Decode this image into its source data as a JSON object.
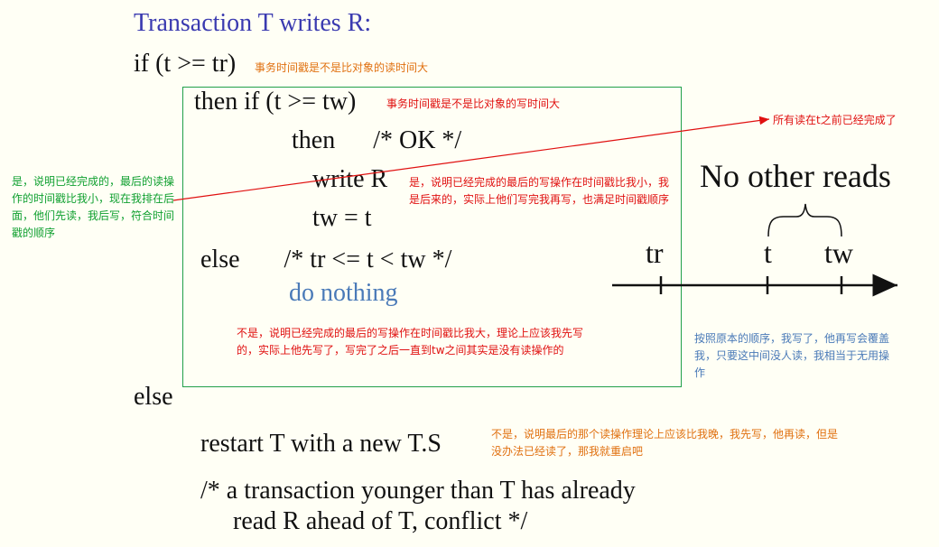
{
  "title": "Transaction T writes R:",
  "lines": {
    "if_line": "if (t >= tr)",
    "then_if": "then if (t >= tw)",
    "then_ok": "then      /* OK */",
    "write_r": "write R",
    "tw_eq_t": "tw = t",
    "else_inner": "else       /* tr <= t < tw */",
    "do_nothing": "do nothing",
    "else_outer": "else",
    "restart": "restart T with a new T.S",
    "comment1": "/* a transaction younger than T has already",
    "comment2": "read R ahead of T, conflict */"
  },
  "timeline": {
    "heading": "No other reads",
    "label_tr": "tr",
    "label_t": "t",
    "label_tw": "tw"
  },
  "notes": {
    "note_if": "事务时间戳是不是比对象的读时间大",
    "note_then_if": "事务时间戳是不是比对象的写时间大",
    "note_arrow": "所有读在t之前已经完成了",
    "note_green": "是，说明已经完成的，最后的读操作的时间戳比我小，现在我排在后面，他们先读，我后写，符合时间戳的顺序",
    "note_write": "是，说明已经完成的最后的写操作在时间戳比我小，我是后来的，实际上他们写完我再写，也满足时间戳顺序",
    "note_else_inner": "不是，说明已经完成的最后的写操作在时间戳比我大，理论上应该我先写的，实际上他先写了，写完了之后一直到tw之间其实是没有读操作的",
    "note_blue": "按照原本的顺序，我写了，他再写会覆盖我，只要这中间没人读，我相当于无用操作",
    "note_restart": "不是，说明最后的那个读操作理论上应该比我晚，我先写，他再读，但是没办法已经读了，那我就重启吧"
  },
  "colors": {
    "title": "#3a3ab0",
    "box": "#22a04a",
    "red": "#e01010",
    "orange": "#e07010",
    "green": "#10a030",
    "blue": "#4a7ab8"
  }
}
